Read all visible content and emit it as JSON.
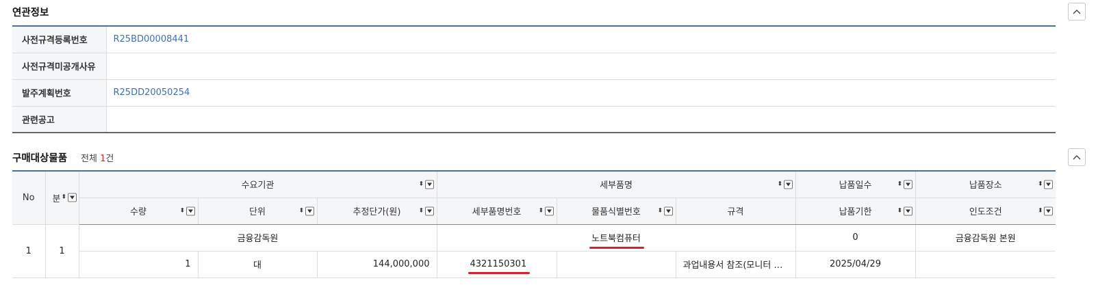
{
  "related": {
    "title": "연관정보",
    "rows": [
      {
        "label": "사전규격등록번호",
        "value": "R25BD00008441"
      },
      {
        "label": "사전규격미공개사유",
        "value": ""
      },
      {
        "label": "발주계획번호",
        "value": "R25DD20050254"
      },
      {
        "label": "관련공고",
        "value": ""
      }
    ]
  },
  "items": {
    "title": "구매대상물품",
    "count_prefix": "전체",
    "count": "1",
    "count_suffix": "건",
    "headers": {
      "no": "No",
      "div": "분",
      "agency": "수요기관",
      "item_name": "세부품명",
      "days": "납품일수",
      "place": "납품장소",
      "qty": "수량",
      "unit": "단위",
      "unit_price": "추정단가(원)",
      "item_no": "세부품명번호",
      "ident_no": "물품식별번호",
      "spec": "규격",
      "deadline": "납품기한",
      "terms": "인도조건"
    },
    "rows": [
      {
        "no": "1",
        "div": "1",
        "agency": "금융감독원",
        "item_name": "노트북컴퓨터",
        "days": "0",
        "place": "금융감독원 본원",
        "qty": "1",
        "unit": "대",
        "unit_price": "144,000,000",
        "item_no": "4321150301",
        "ident_no": "",
        "spec": "과업내용서 참조(모니터 …",
        "deadline": "2025/04/29",
        "terms": ""
      }
    ]
  },
  "colors": {
    "accent": "#4a6fa5",
    "link": "#3d6fb6",
    "highlight": "#d61f2b",
    "count": "#d4281d"
  },
  "icons": {
    "collapse": "chevron-up-icon",
    "sort": "sort-updown-icon",
    "filter": "filter-dropdown-icon"
  }
}
